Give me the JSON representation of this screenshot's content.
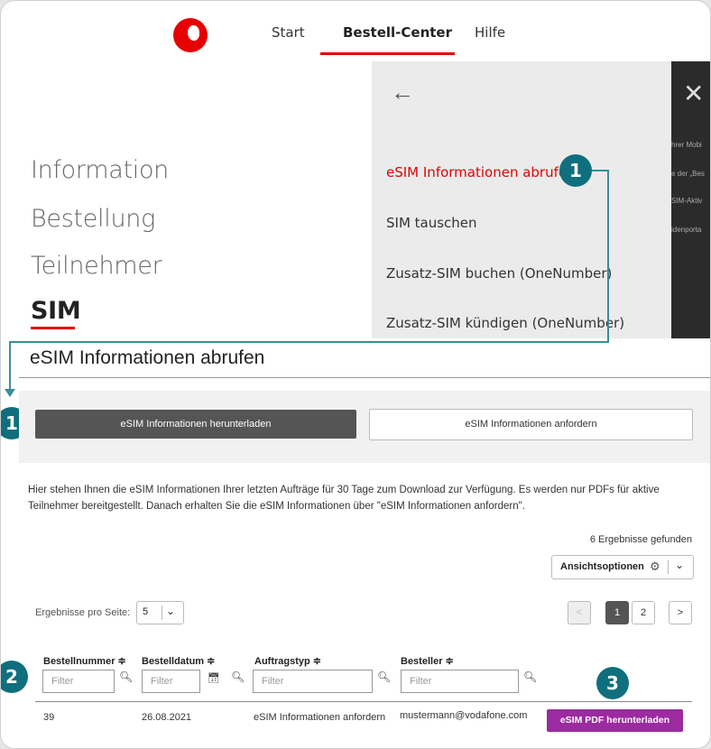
{
  "header": {
    "nav": [
      "Start",
      "Bestell-Center",
      "Hilfe"
    ],
    "active_tab": "Bestell-Center"
  },
  "left_menu": [
    "Information",
    "Bestellung",
    "Teilnehmer",
    "SIM"
  ],
  "sim_menu": {
    "back_icon": "arrow-left-icon",
    "items": [
      "eSIM Informationen abrufen",
      "SIM tauschen",
      "Zusatz-SIM buchen (OneNumber)",
      "Zusatz-SIM kündigen (OneNumber)"
    ]
  },
  "overlay_snippets": [
    "hrer Mobi",
    "e der „Bes",
    "SIM-Aktiv",
    "idenporta"
  ],
  "badges": {
    "one": "1",
    "two": "2",
    "three": "3"
  },
  "section": {
    "title": "eSIM Informationen abrufen",
    "button_download": "eSIM Informationen herunterladen",
    "button_request": "eSIM Informationen anfordern",
    "info_text": "Hier stehen Ihnen die eSIM Informationen Ihrer letzten Aufträge für 30 Tage zum Download zur Verfügung. Es werden nur PDFs für aktive Teilnehmer bereitgestellt. Danach erhalten Sie die eSIM Informationen über \"eSIM Informationen anfordern\"."
  },
  "results": {
    "count_text": "6 Ergebnisse gefunden",
    "view_options": "Ansichtsoptionen",
    "per_page_label": "Ergebnisse pro Seite:",
    "per_page_value": "5"
  },
  "pagination": {
    "prev": "<",
    "pages": [
      "1",
      "2"
    ],
    "current": "1",
    "next": ">"
  },
  "table": {
    "columns": [
      "Bestellnummer ≑",
      "Bestelldatum ≑",
      "Auftragstyp ≑",
      "Besteller ≑"
    ],
    "filter_placeholder": "Filter",
    "rows": [
      {
        "nummer": "39",
        "datum": "26.08.2021",
        "typ": "eSIM Informationen anfordern",
        "besteller": "mustermann@vodafone.com",
        "action": "eSIM PDF herunterladen"
      }
    ]
  },
  "colors": {
    "brand_red": "#e60000",
    "badge_teal": "#0f6f7d",
    "pdf_purple": "#9c2aa0"
  }
}
